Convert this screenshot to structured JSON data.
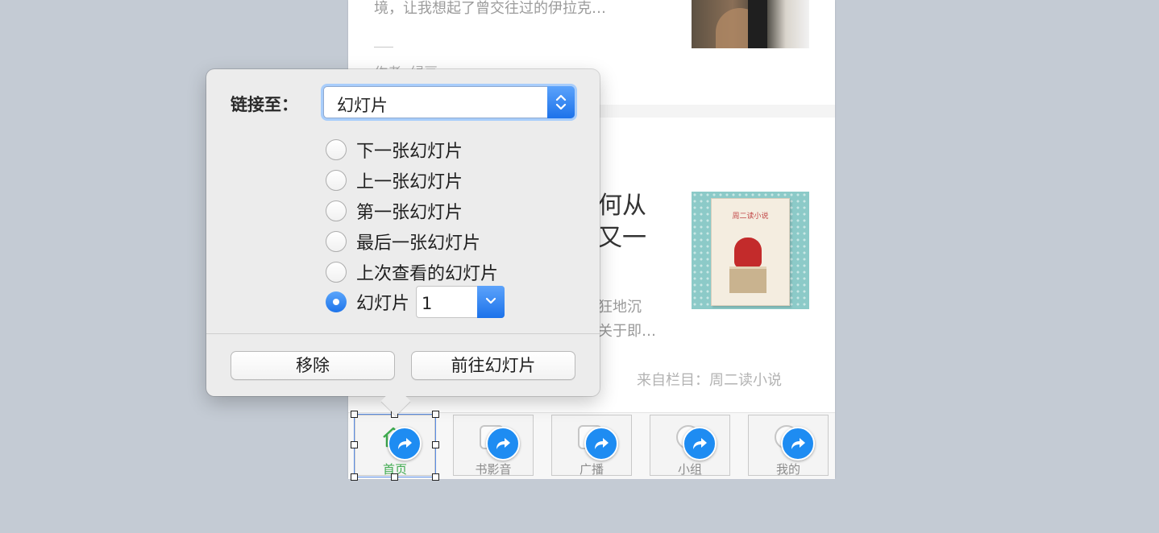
{
  "slide": {
    "article_excerpt": "境，让我想起了曾交往过的伊拉克…",
    "author": "作者: 绿豆",
    "title_line1_fragment": "何从",
    "title_line2_fragment": "又一",
    "excerpt_line1_fragment": "狂地沉",
    "excerpt_line2_fragment": "关于即…",
    "source": "来自栏目：周二读小说",
    "book_cover_title": "周二读小说"
  },
  "tabbar": {
    "tabs": [
      {
        "label": "首页",
        "icon": "home-icon",
        "active": true
      },
      {
        "label": "书影音",
        "icon": "book-movie-music-icon",
        "active": false
      },
      {
        "label": "广播",
        "icon": "broadcast-icon",
        "active": false
      },
      {
        "label": "小组",
        "icon": "group-icon",
        "active": false
      },
      {
        "label": "我的",
        "icon": "profile-icon",
        "active": false
      }
    ],
    "link_badge_icon": "link-arrow-icon"
  },
  "popover": {
    "link_to_label": "链接至：",
    "link_to_value": "幻灯片",
    "options": [
      {
        "label": "下一张幻灯片",
        "checked": false
      },
      {
        "label": "上一张幻灯片",
        "checked": false
      },
      {
        "label": "第一张幻灯片",
        "checked": false
      },
      {
        "label": "最后一张幻灯片",
        "checked": false
      },
      {
        "label": "上次查看的幻灯片",
        "checked": false
      },
      {
        "label": "幻灯片",
        "checked": true
      }
    ],
    "slide_number": "1",
    "remove_button": "移除",
    "go_to_slide_button": "前往幻灯片"
  },
  "colors": {
    "background": "#c4cbd4",
    "accent_blue": "#1e8cf2",
    "active_tab_green": "#3eaa4e"
  }
}
